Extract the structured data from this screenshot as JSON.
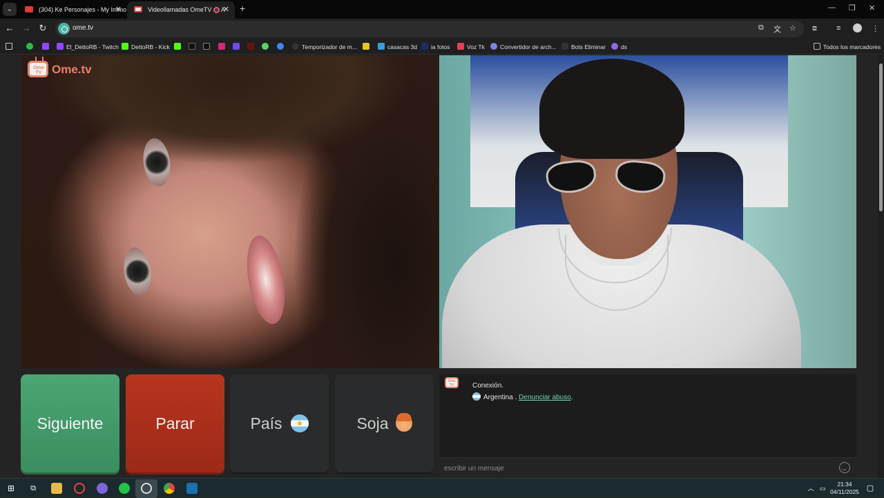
{
  "browser": {
    "tabs": [
      {
        "title": "(304) Ke Personajes - My Immo",
        "active": false
      },
      {
        "title": "Videollamadas OmeTV — A",
        "active": true
      }
    ],
    "url": "ome.tv",
    "bookmarks": [
      {
        "label": "El_DettoRB - Twitch"
      },
      {
        "label": "DettoRB - Kick"
      },
      {
        "label": "Temporizador de m..."
      },
      {
        "label": "casacas 3d"
      },
      {
        "label": "ia fotos"
      },
      {
        "label": "Voz Tk"
      },
      {
        "label": "Convertidor de arch..."
      },
      {
        "label": "Bots Eliminar"
      },
      {
        "label": "ds"
      }
    ],
    "all_bookmarks": "Todos los marcadores"
  },
  "page": {
    "logo_text": "Ome.tv",
    "logo_tv": "Ome TV",
    "buttons": {
      "next": "Siguiente",
      "stop": "Parar",
      "country": "País",
      "gender": "Soja"
    },
    "chat": {
      "status": "Conexión.",
      "country": "Argentina",
      "separator": " . ",
      "report_link": "Denunciar abuso",
      "report_suffix": ".",
      "placeholder": "escribir un mensaje"
    }
  },
  "taskbar": {
    "time": "21:34",
    "date": "04/11/2025"
  },
  "colors": {
    "next": "#3e9466",
    "stop": "#a82e1a",
    "link": "#6fd3b5",
    "logo": "#e7806a"
  }
}
